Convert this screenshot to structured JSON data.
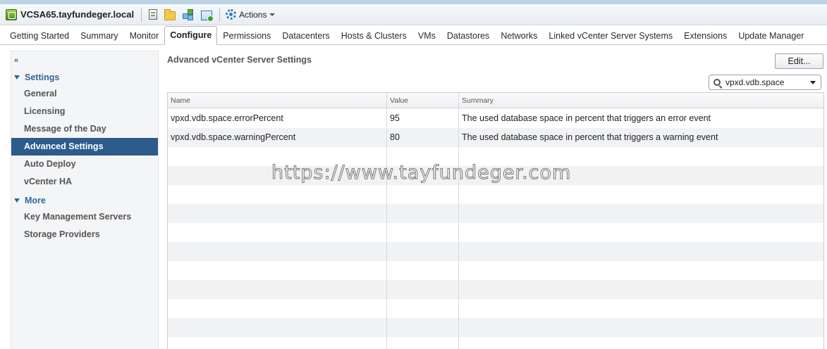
{
  "object_bar": {
    "title": "VCSA65.tayfundeger.local",
    "actions_label": "Actions",
    "toolbar_icons": [
      "new-host-icon",
      "new-folder-icon",
      "new-vapp-icon",
      "new-vm-icon"
    ]
  },
  "tabs": [
    {
      "label": "Getting Started"
    },
    {
      "label": "Summary"
    },
    {
      "label": "Monitor"
    },
    {
      "label": "Configure",
      "active": true
    },
    {
      "label": "Permissions"
    },
    {
      "label": "Datacenters"
    },
    {
      "label": "Hosts & Clusters"
    },
    {
      "label": "VMs"
    },
    {
      "label": "Datastores"
    },
    {
      "label": "Networks"
    },
    {
      "label": "Linked vCenter Server Systems"
    },
    {
      "label": "Extensions"
    },
    {
      "label": "Update Manager"
    }
  ],
  "sidebar": {
    "collapse_icon": "«",
    "settings_header": "Settings",
    "settings_items": [
      {
        "label": "General"
      },
      {
        "label": "Licensing"
      },
      {
        "label": "Message of the Day"
      },
      {
        "label": "Advanced Settings",
        "selected": true
      },
      {
        "label": "Auto Deploy"
      },
      {
        "label": "vCenter HA"
      }
    ],
    "more_header": "More",
    "more_items": [
      {
        "label": "Key Management Servers"
      },
      {
        "label": "Storage Providers"
      }
    ]
  },
  "main": {
    "title": "Advanced vCenter Server Settings",
    "edit_label": "Edit...",
    "filter_value": "vpxd.vdb.space",
    "columns": [
      "Name",
      "Value",
      "Summary"
    ],
    "rows": [
      {
        "name": "vpxd.vdb.space.errorPercent",
        "value": "95",
        "summary": "The used database space in percent that triggers an error event"
      },
      {
        "name": "vpxd.vdb.space.warningPercent",
        "value": "80",
        "summary": "The used database space in percent that triggers a warning event"
      }
    ]
  },
  "watermark": "https://www.tayfundeger.com",
  "colors": {
    "nav_selected": "#2d5b8c",
    "nav_header": "#336699",
    "row_alt": "#f1f2f4"
  }
}
